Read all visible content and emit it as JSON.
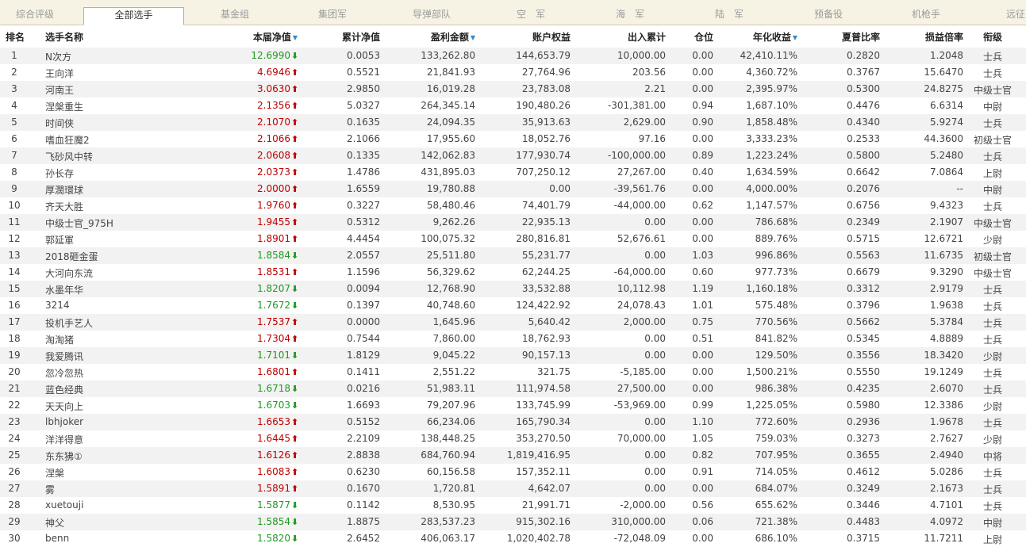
{
  "tabs": [
    {
      "label": "综合评级",
      "active": false
    },
    {
      "label": "全部选手",
      "active": true
    },
    {
      "label": "基金组",
      "active": false
    },
    {
      "label": "集团军",
      "active": false
    },
    {
      "label": "导弹部队",
      "active": false
    },
    {
      "label": "空　军",
      "active": false
    },
    {
      "label": "海　军",
      "active": false
    },
    {
      "label": "陆　军",
      "active": false
    },
    {
      "label": "预备役",
      "active": false
    },
    {
      "label": "机枪手",
      "active": false
    },
    {
      "label": "远征",
      "active": false
    }
  ],
  "columns": {
    "rank": "排名",
    "name": "选手名称",
    "nav": "本届净值",
    "cum_nav": "累计净值",
    "profit": "盈利金额",
    "equity": "账户权益",
    "io": "出入累计",
    "position": "仓位",
    "annual": "年化收益",
    "sharpe": "夏普比率",
    "pl_ratio": "损益倍率",
    "grade": "衔级"
  },
  "sorted_columns_icon": "sort-down-icon",
  "colors": {
    "up": "#c00000",
    "down": "#1f9a1f",
    "tab_bar": "#f7f3e4",
    "alt_row": "#f2f2f2"
  },
  "rows": [
    {
      "rank": "1",
      "name": "N次方",
      "nav": "12.6990",
      "trend": "down",
      "cum_nav": "0.0053",
      "profit": "133,262.80",
      "equity": "144,653.79",
      "io": "10,000.00",
      "position": "0.00",
      "annual": "42,410.11%",
      "sharpe": "0.2820",
      "pl_ratio": "1.2048",
      "grade": "士兵"
    },
    {
      "rank": "2",
      "name": "王向洋",
      "nav": "4.6946",
      "trend": "up",
      "cum_nav": "0.5521",
      "profit": "21,841.93",
      "equity": "27,764.96",
      "io": "203.56",
      "position": "0.00",
      "annual": "4,360.72%",
      "sharpe": "0.3767",
      "pl_ratio": "15.6470",
      "grade": "士兵"
    },
    {
      "rank": "3",
      "name": "河南王",
      "nav": "3.0630",
      "trend": "up",
      "cum_nav": "2.9850",
      "profit": "16,019.28",
      "equity": "23,783.08",
      "io": "2.21",
      "position": "0.00",
      "annual": "2,395.97%",
      "sharpe": "0.5300",
      "pl_ratio": "24.8275",
      "grade": "中级士官"
    },
    {
      "rank": "4",
      "name": "涅槃重生",
      "nav": "2.1356",
      "trend": "up",
      "cum_nav": "5.0327",
      "profit": "264,345.14",
      "equity": "190,480.26",
      "io": "-301,381.00",
      "position": "0.94",
      "annual": "1,687.10%",
      "sharpe": "0.4476",
      "pl_ratio": "6.6314",
      "grade": "中尉"
    },
    {
      "rank": "5",
      "name": "时间侠",
      "nav": "2.1070",
      "trend": "up",
      "cum_nav": "0.1635",
      "profit": "24,094.35",
      "equity": "35,913.63",
      "io": "2,629.00",
      "position": "0.90",
      "annual": "1,858.48%",
      "sharpe": "0.4340",
      "pl_ratio": "5.9274",
      "grade": "士兵"
    },
    {
      "rank": "6",
      "name": "嗜血狂魔2",
      "nav": "2.1066",
      "trend": "up",
      "cum_nav": "2.1066",
      "profit": "17,955.60",
      "equity": "18,052.76",
      "io": "97.16",
      "position": "0.00",
      "annual": "3,333.23%",
      "sharpe": "0.2533",
      "pl_ratio": "44.3600",
      "grade": "初级士官"
    },
    {
      "rank": "7",
      "name": "飞砂风中转",
      "nav": "2.0608",
      "trend": "up",
      "cum_nav": "0.1335",
      "profit": "142,062.83",
      "equity": "177,930.74",
      "io": "-100,000.00",
      "position": "0.89",
      "annual": "1,223.24%",
      "sharpe": "0.5800",
      "pl_ratio": "5.2480",
      "grade": "士兵"
    },
    {
      "rank": "8",
      "name": "孙长存",
      "nav": "2.0373",
      "trend": "up",
      "cum_nav": "1.4786",
      "profit": "431,895.03",
      "equity": "707,250.12",
      "io": "27,267.00",
      "position": "0.40",
      "annual": "1,634.59%",
      "sharpe": "0.6642",
      "pl_ratio": "7.0864",
      "grade": "上尉"
    },
    {
      "rank": "9",
      "name": "厚濶環球",
      "nav": "2.0000",
      "trend": "up",
      "cum_nav": "1.6559",
      "profit": "19,780.88",
      "equity": "0.00",
      "io": "-39,561.76",
      "position": "0.00",
      "annual": "4,000.00%",
      "sharpe": "0.2076",
      "pl_ratio": "--",
      "grade": "中尉"
    },
    {
      "rank": "10",
      "name": "齐天大胜",
      "nav": "1.9760",
      "trend": "up",
      "cum_nav": "0.3227",
      "profit": "58,480.46",
      "equity": "74,401.79",
      "io": "-44,000.00",
      "position": "0.62",
      "annual": "1,147.57%",
      "sharpe": "0.6756",
      "pl_ratio": "9.4323",
      "grade": "士兵"
    },
    {
      "rank": "11",
      "name": "中级士官_975H",
      "nav": "1.9455",
      "trend": "up",
      "cum_nav": "0.5312",
      "profit": "9,262.26",
      "equity": "22,935.13",
      "io": "0.00",
      "position": "0.00",
      "annual": "786.68%",
      "sharpe": "0.2349",
      "pl_ratio": "2.1907",
      "grade": "中级士官"
    },
    {
      "rank": "12",
      "name": "郭延軍",
      "nav": "1.8901",
      "trend": "up",
      "cum_nav": "4.4454",
      "profit": "100,075.32",
      "equity": "280,816.81",
      "io": "52,676.61",
      "position": "0.00",
      "annual": "889.76%",
      "sharpe": "0.5715",
      "pl_ratio": "12.6721",
      "grade": "少尉"
    },
    {
      "rank": "13",
      "name": "2018砸金蛋",
      "nav": "1.8584",
      "trend": "down",
      "cum_nav": "2.0557",
      "profit": "25,511.80",
      "equity": "55,231.77",
      "io": "0.00",
      "position": "1.03",
      "annual": "996.86%",
      "sharpe": "0.5563",
      "pl_ratio": "11.6735",
      "grade": "初级士官"
    },
    {
      "rank": "14",
      "name": "大河向东流",
      "nav": "1.8531",
      "trend": "up",
      "cum_nav": "1.1596",
      "profit": "56,329.62",
      "equity": "62,244.25",
      "io": "-64,000.00",
      "position": "0.60",
      "annual": "977.73%",
      "sharpe": "0.6679",
      "pl_ratio": "9.3290",
      "grade": "中级士官"
    },
    {
      "rank": "15",
      "name": "水墨年华",
      "nav": "1.8207",
      "trend": "down",
      "cum_nav": "0.0094",
      "profit": "12,768.90",
      "equity": "33,532.88",
      "io": "10,112.98",
      "position": "1.19",
      "annual": "1,160.18%",
      "sharpe": "0.3312",
      "pl_ratio": "2.9179",
      "grade": "士兵"
    },
    {
      "rank": "16",
      "name": "3214",
      "nav": "1.7672",
      "trend": "down",
      "cum_nav": "0.1397",
      "profit": "40,748.60",
      "equity": "124,422.92",
      "io": "24,078.43",
      "position": "1.01",
      "annual": "575.48%",
      "sharpe": "0.3796",
      "pl_ratio": "1.9638",
      "grade": "士兵"
    },
    {
      "rank": "17",
      "name": "投机手艺人",
      "nav": "1.7537",
      "trend": "up",
      "cum_nav": "0.0000",
      "profit": "1,645.96",
      "equity": "5,640.42",
      "io": "2,000.00",
      "position": "0.75",
      "annual": "770.56%",
      "sharpe": "0.5662",
      "pl_ratio": "5.3784",
      "grade": "士兵"
    },
    {
      "rank": "18",
      "name": "淘淘猪",
      "nav": "1.7304",
      "trend": "up",
      "cum_nav": "0.7544",
      "profit": "7,860.00",
      "equity": "18,762.93",
      "io": "0.00",
      "position": "0.51",
      "annual": "841.82%",
      "sharpe": "0.5345",
      "pl_ratio": "4.8889",
      "grade": "士兵"
    },
    {
      "rank": "19",
      "name": "我爱腾讯",
      "nav": "1.7101",
      "trend": "down",
      "cum_nav": "1.8129",
      "profit": "9,045.22",
      "equity": "90,157.13",
      "io": "0.00",
      "position": "0.00",
      "annual": "129.50%",
      "sharpe": "0.3556",
      "pl_ratio": "18.3420",
      "grade": "少尉"
    },
    {
      "rank": "20",
      "name": "忽冷忽热",
      "nav": "1.6801",
      "trend": "up",
      "cum_nav": "0.1411",
      "profit": "2,551.22",
      "equity": "321.75",
      "io": "-5,185.00",
      "position": "0.00",
      "annual": "1,500.21%",
      "sharpe": "0.5550",
      "pl_ratio": "19.1249",
      "grade": "士兵"
    },
    {
      "rank": "21",
      "name": "蓝色经典",
      "nav": "1.6718",
      "trend": "down",
      "cum_nav": "0.0216",
      "profit": "51,983.11",
      "equity": "111,974.58",
      "io": "27,500.00",
      "position": "0.00",
      "annual": "986.38%",
      "sharpe": "0.4235",
      "pl_ratio": "2.6070",
      "grade": "士兵"
    },
    {
      "rank": "22",
      "name": "天天向上",
      "nav": "1.6703",
      "trend": "down",
      "cum_nav": "1.6693",
      "profit": "79,207.96",
      "equity": "133,745.99",
      "io": "-53,969.00",
      "position": "0.99",
      "annual": "1,225.05%",
      "sharpe": "0.5980",
      "pl_ratio": "12.3386",
      "grade": "少尉"
    },
    {
      "rank": "23",
      "name": "lbhjoker",
      "nav": "1.6653",
      "trend": "up",
      "cum_nav": "0.5152",
      "profit": "66,234.06",
      "equity": "165,790.34",
      "io": "0.00",
      "position": "1.10",
      "annual": "772.60%",
      "sharpe": "0.2936",
      "pl_ratio": "1.9678",
      "grade": "士兵"
    },
    {
      "rank": "24",
      "name": "洋洋得意",
      "nav": "1.6445",
      "trend": "up",
      "cum_nav": "2.2109",
      "profit": "138,448.25",
      "equity": "353,270.50",
      "io": "70,000.00",
      "position": "1.05",
      "annual": "759.03%",
      "sharpe": "0.3273",
      "pl_ratio": "2.7627",
      "grade": "少尉"
    },
    {
      "rank": "25",
      "name": "东东狒①",
      "nav": "1.6126",
      "trend": "up",
      "cum_nav": "2.8838",
      "profit": "684,760.94",
      "equity": "1,819,416.95",
      "io": "0.00",
      "position": "0.82",
      "annual": "707.95%",
      "sharpe": "0.3655",
      "pl_ratio": "2.4940",
      "grade": "中将"
    },
    {
      "rank": "26",
      "name": "涅槃",
      "nav": "1.6083",
      "trend": "up",
      "cum_nav": "0.6230",
      "profit": "60,156.58",
      "equity": "157,352.11",
      "io": "0.00",
      "position": "0.91",
      "annual": "714.05%",
      "sharpe": "0.4612",
      "pl_ratio": "5.0286",
      "grade": "士兵"
    },
    {
      "rank": "27",
      "name": "雾",
      "nav": "1.5891",
      "trend": "up",
      "cum_nav": "0.1670",
      "profit": "1,720.81",
      "equity": "4,642.07",
      "io": "0.00",
      "position": "0.00",
      "annual": "684.07%",
      "sharpe": "0.3249",
      "pl_ratio": "2.1673",
      "grade": "士兵"
    },
    {
      "rank": "28",
      "name": "xuetouji",
      "nav": "1.5877",
      "trend": "down",
      "cum_nav": "0.1142",
      "profit": "8,530.95",
      "equity": "21,991.71",
      "io": "-2,000.00",
      "position": "0.56",
      "annual": "655.62%",
      "sharpe": "0.3446",
      "pl_ratio": "4.7101",
      "grade": "士兵"
    },
    {
      "rank": "29",
      "name": "神父",
      "nav": "1.5854",
      "trend": "down",
      "cum_nav": "1.8875",
      "profit": "283,537.23",
      "equity": "915,302.16",
      "io": "310,000.00",
      "position": "0.06",
      "annual": "721.38%",
      "sharpe": "0.4483",
      "pl_ratio": "4.0972",
      "grade": "中尉"
    },
    {
      "rank": "30",
      "name": "benn",
      "nav": "1.5820",
      "trend": "down",
      "cum_nav": "2.6452",
      "profit": "406,063.17",
      "equity": "1,020,402.78",
      "io": "-72,048.09",
      "position": "0.00",
      "annual": "686.10%",
      "sharpe": "0.3715",
      "pl_ratio": "11.7211",
      "grade": "上尉"
    }
  ]
}
